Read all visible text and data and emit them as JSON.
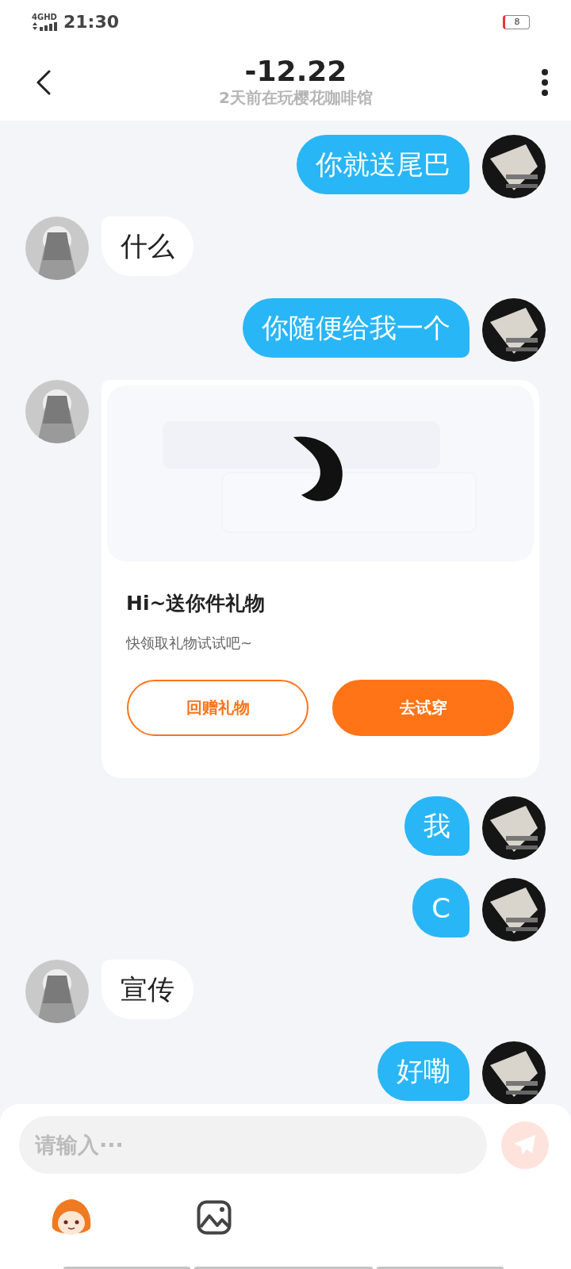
{
  "status_bar": {
    "network": "4GHD",
    "time": "21:30",
    "battery": "8"
  },
  "header": {
    "title": "-12.22",
    "subtitle": "2天前在玩樱花咖啡馆"
  },
  "messages": [
    {
      "kind": "text",
      "outgoing": true,
      "text": "你就送尾巴"
    },
    {
      "kind": "text",
      "outgoing": false,
      "text": "什么"
    },
    {
      "kind": "text",
      "outgoing": true,
      "text": "你随便给我一个"
    },
    {
      "kind": "gift",
      "outgoing": false,
      "title": "Hi~送你件礼物",
      "subtitle": "快领取礼物试试吧~",
      "buttons": [
        {
          "label": "回赠礼物",
          "kind": "outline"
        },
        {
          "label": "去试穿",
          "kind": "filled"
        }
      ]
    },
    {
      "kind": "text",
      "outgoing": true,
      "text": "我"
    },
    {
      "kind": "text",
      "outgoing": true,
      "text": "C"
    },
    {
      "kind": "text",
      "outgoing": false,
      "text": "宣传"
    },
    {
      "kind": "text",
      "outgoing": true,
      "text": "好嘞"
    }
  ],
  "composer": {
    "placeholder": "请输入···"
  }
}
